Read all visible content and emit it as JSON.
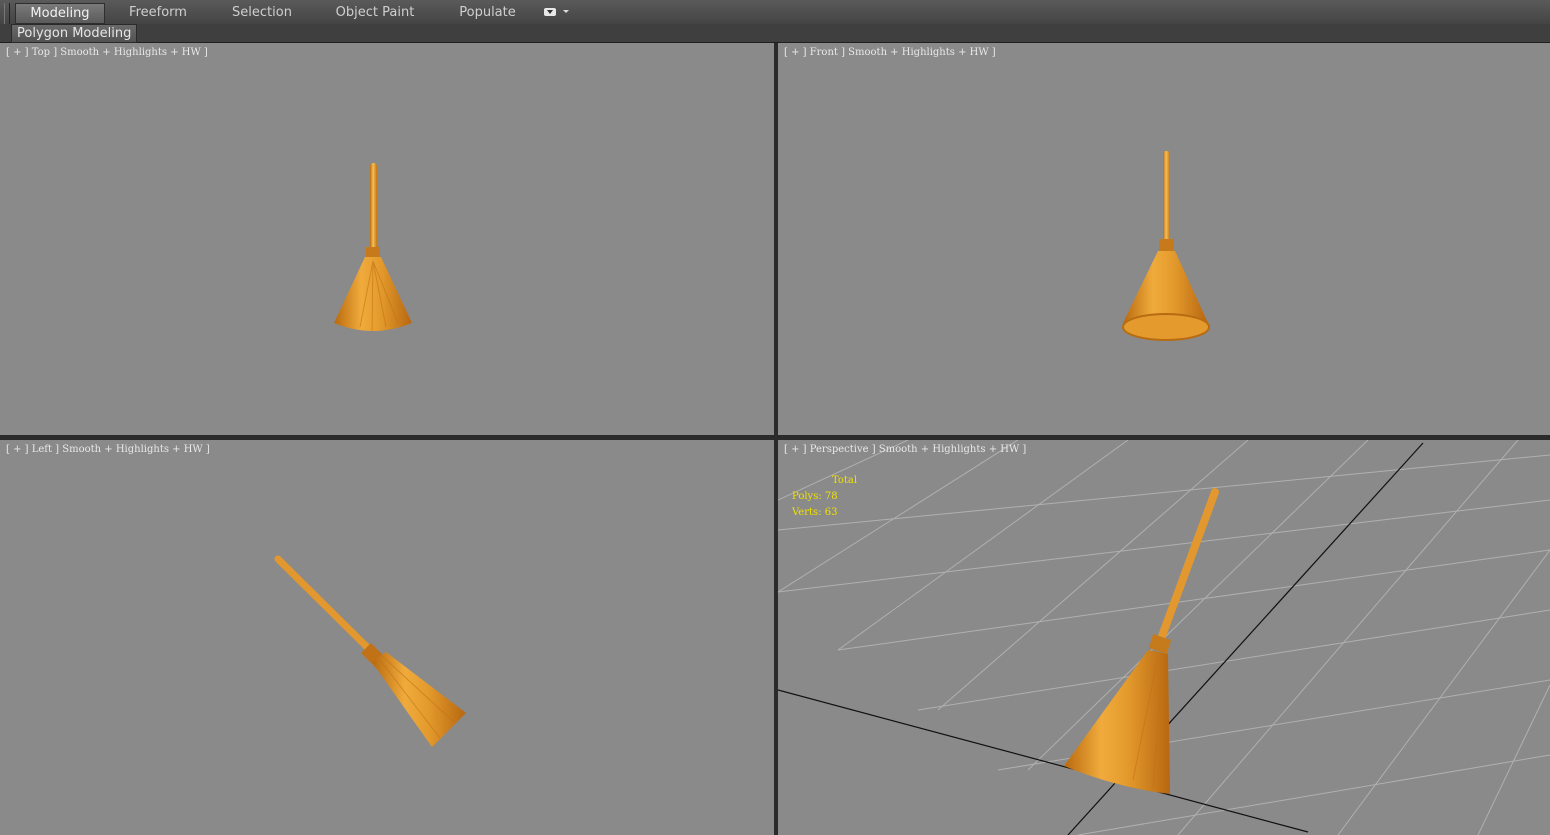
{
  "ribbon": {
    "tabs": [
      {
        "label": "Modeling",
        "active": true
      },
      {
        "label": "Freeform"
      },
      {
        "label": "Selection"
      },
      {
        "label": "Object Paint"
      },
      {
        "label": "Populate"
      }
    ],
    "options_icon": "ribbon-options-icon"
  },
  "panel": {
    "label": "Polygon Modeling"
  },
  "viewports": {
    "top": {
      "label": "[ + ] Top ] Smooth + Highlights + HW ]"
    },
    "front": {
      "label": "[ + ] Front ] Smooth + Highlights + HW ]"
    },
    "left": {
      "label": "[ + ] Left ] Smooth + Highlights + HW ]"
    },
    "perspective": {
      "label": "[ + ] Perspective ] Smooth + Highlights + HW ]",
      "stats": {
        "header": "Total",
        "polys": "Polys: 78",
        "verts": "Verts: 63"
      }
    }
  },
  "colors": {
    "viewport_bg": "#8a8a8a",
    "stats_text": "#f0e000",
    "broom": "#e3962a"
  }
}
